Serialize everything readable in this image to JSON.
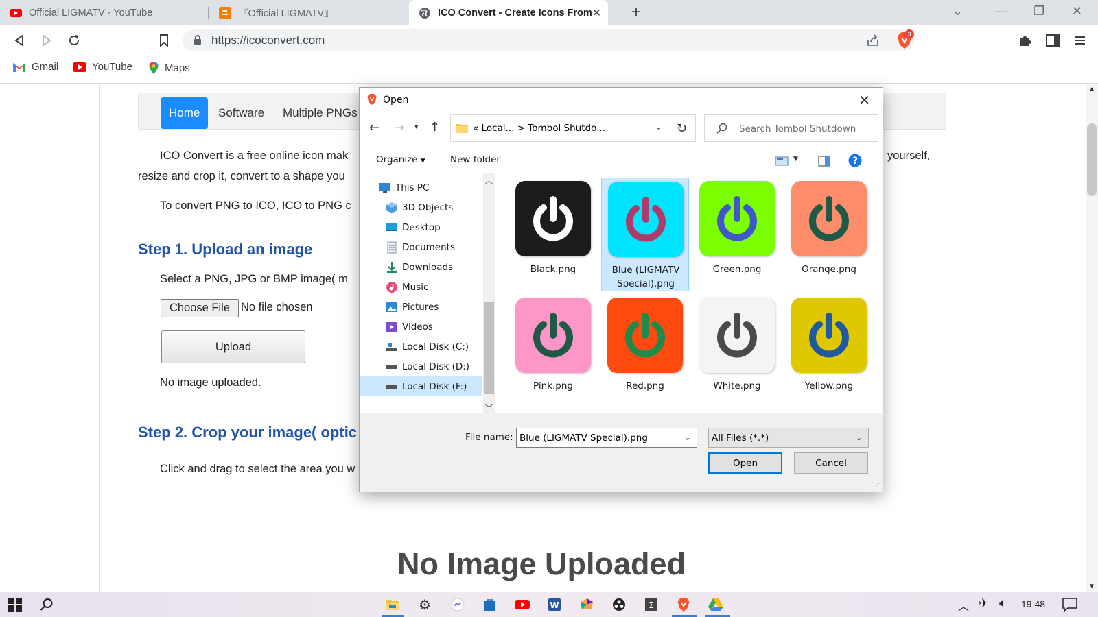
{
  "tabs": [
    {
      "title": "Official LIGMATV - YouTube"
    },
    {
      "title": "『Official LIGMATV』"
    },
    {
      "title": "ICO Convert - Create Icons From I"
    }
  ],
  "address": {
    "url": "https://icoconvert.com"
  },
  "brave_badge": "3",
  "bookmarks": [
    {
      "label": "Gmail"
    },
    {
      "label": "YouTube"
    },
    {
      "label": "Maps"
    }
  ],
  "site": {
    "nav": [
      {
        "label": "Home",
        "active": true
      },
      {
        "label": "Software"
      },
      {
        "label": "Multiple PNGs"
      }
    ],
    "intro_line1": "ICO Convert is a free online icon mak",
    "intro_right": "yourself,",
    "intro_line2": "resize and crop it, convert to a shape you",
    "intro_line3": "To convert PNG to ICO, ICO to PNG c",
    "step1_heading": "Step 1. Upload an image",
    "step1_text": "Select a PNG, JPG or BMP image( m",
    "choose_file": "Choose File",
    "no_file": "No file chosen",
    "upload": "Upload",
    "no_image": "No image uploaded.",
    "step2_heading": "Step 2. Crop your image( optic",
    "step2_text": "Click and drag to select the area you w",
    "big_text": "No Image Uploaded"
  },
  "dialog": {
    "title": "Open",
    "breadcrumb": "«  Local...  >  Tombol Shutdo...",
    "search_placeholder": "Search Tombol Shutdown",
    "organize": "Organize",
    "new_folder": "New folder",
    "nav_items": [
      {
        "label": "This PC",
        "icon": "pc-icon"
      },
      {
        "label": "3D Objects",
        "icon": "3d-objects-icon"
      },
      {
        "label": "Desktop",
        "icon": "desktop-icon"
      },
      {
        "label": "Documents",
        "icon": "documents-icon"
      },
      {
        "label": "Downloads",
        "icon": "downloads-icon"
      },
      {
        "label": "Music",
        "icon": "music-icon"
      },
      {
        "label": "Pictures",
        "icon": "pictures-icon"
      },
      {
        "label": "Videos",
        "icon": "videos-icon"
      },
      {
        "label": "Local Disk (C:)",
        "icon": "drive-icon"
      },
      {
        "label": "Local Disk (D:)",
        "icon": "drive-icon"
      },
      {
        "label": "Local Disk (F:)",
        "icon": "drive-icon",
        "selected": true
      }
    ],
    "files": [
      {
        "name": "Black.png",
        "bg": "#1c1c1c",
        "fg": "#ffffff"
      },
      {
        "name": "Blue (LIGMATV Special).png",
        "bg": "#00e5ff",
        "fg": "#b03a6a",
        "selected": true
      },
      {
        "name": "Green.png",
        "bg": "#7cff00",
        "fg": "#3f57c8"
      },
      {
        "name": "Orange.png",
        "bg": "#ff8c6b",
        "fg": "#1f5a46"
      },
      {
        "name": "Pink.png",
        "bg": "#ff96c8",
        "fg": "#1f5a46"
      },
      {
        "name": "Red.png",
        "bg": "#ff4a10",
        "fg": "#1f8a4a"
      },
      {
        "name": "White.png",
        "bg": "#f4f4f4",
        "fg": "#4a4a4a"
      },
      {
        "name": "Yellow.png",
        "bg": "#e0c800",
        "fg": "#1f5aa0"
      }
    ],
    "file_name_label": "File name:",
    "file_name_value": "Blue (LIGMATV Special).png",
    "file_type": "All Files (*.*)",
    "open_button": "Open",
    "cancel_button": "Cancel"
  },
  "taskbar": {
    "clock": "19.48"
  }
}
